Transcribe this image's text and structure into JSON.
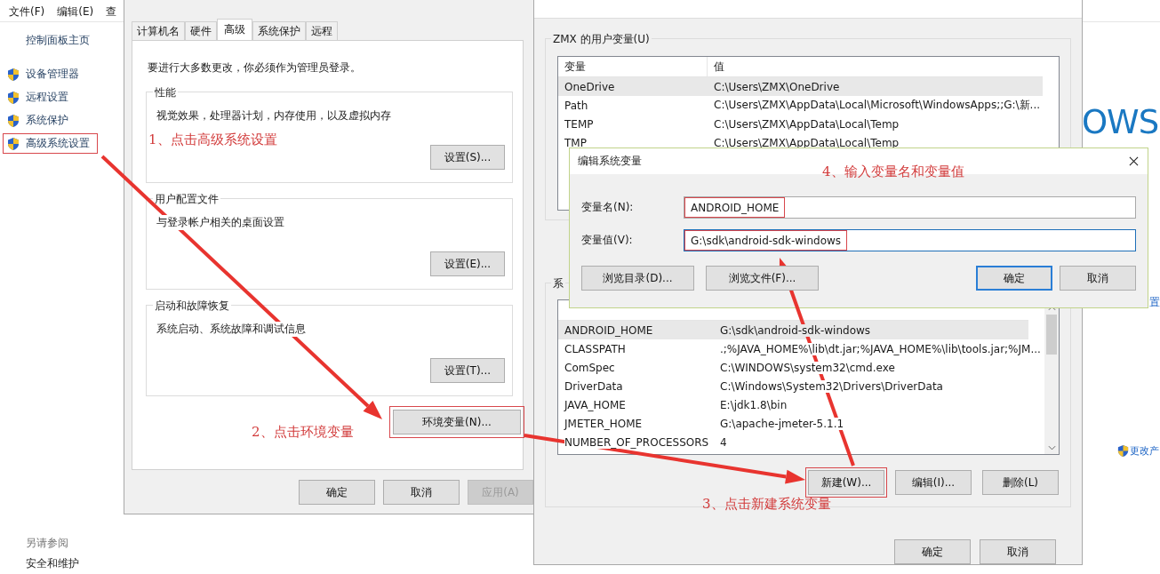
{
  "control_panel": {
    "menu": [
      "文件(F)",
      "编辑(E)",
      "查"
    ],
    "home_link": "控制面板主页",
    "tasks": [
      {
        "label": "设备管理器",
        "highlighted": false
      },
      {
        "label": "远程设置",
        "highlighted": false
      },
      {
        "label": "系统保护",
        "highlighted": false
      },
      {
        "label": "高级系统设置",
        "highlighted": true
      }
    ],
    "see_also_heading": "另请参阅",
    "see_also_link": "安全和维护",
    "brand_text": "OWS",
    "side_link": "置",
    "change_link": "更改产"
  },
  "system_properties": {
    "tabs": [
      {
        "label": "计算机名",
        "selected": false
      },
      {
        "label": "硬件",
        "selected": false
      },
      {
        "label": "高级",
        "selected": true
      },
      {
        "label": "系统保护",
        "selected": false
      },
      {
        "label": "远程",
        "selected": false
      }
    ],
    "admin_note": "要进行大多数更改，你必须作为管理员登录。",
    "groups": [
      {
        "title": "性能",
        "description": "视觉效果，处理器计划，内存使用，以及虚拟内存",
        "button": "设置(S)..."
      },
      {
        "title": "用户配置文件",
        "description": "与登录帐户相关的桌面设置",
        "button": "设置(E)..."
      },
      {
        "title": "启动和故障恢复",
        "description": "系统启动、系统故障和调试信息",
        "button": "设置(T)..."
      }
    ],
    "env_button": {
      "label": "环境变量(N)...",
      "highlighted": true
    },
    "buttons": [
      {
        "label": "确定",
        "disabled": false
      },
      {
        "label": "取消",
        "disabled": false
      },
      {
        "label": "应用(A)",
        "disabled": true
      }
    ]
  },
  "environment_variables": {
    "user_group_title": "ZMX 的用户变量(U)",
    "columns": [
      "变量",
      "值"
    ],
    "user_rows": [
      {
        "name": "OneDrive",
        "value": "C:\\Users\\ZMX\\OneDrive",
        "selected": true
      },
      {
        "name": "Path",
        "value": "C:\\Users\\ZMX\\AppData\\Local\\Microsoft\\WindowsApps;;G:\\新...",
        "selected": false
      },
      {
        "name": "TEMP",
        "value": "C:\\Users\\ZMX\\AppData\\Local\\Temp",
        "selected": false
      },
      {
        "name": "TMP",
        "value": "C:\\Users\\ZMX\\AppData\\Local\\Temp",
        "selected": false
      }
    ],
    "system_group_title": "系",
    "system_rows": [
      {
        "name": "ANDROID_HOME",
        "value": "G:\\sdk\\android-sdk-windows",
        "selected": true
      },
      {
        "name": "CLASSPATH",
        "value": ".;%JAVA_HOME%\\lib\\dt.jar;%JAVA_HOME%\\lib\\tools.jar;%JM...",
        "selected": false
      },
      {
        "name": "ComSpec",
        "value": "C:\\WINDOWS\\system32\\cmd.exe",
        "selected": false
      },
      {
        "name": "DriverData",
        "value": "C:\\Windows\\System32\\Drivers\\DriverData",
        "selected": false
      },
      {
        "name": "JAVA_HOME",
        "value": "E:\\jdk1.8\\bin",
        "selected": false
      },
      {
        "name": "JMETER_HOME",
        "value": "G:\\apache-jmeter-5.1.1",
        "selected": false
      },
      {
        "name": "NUMBER_OF_PROCESSORS",
        "value": "4",
        "selected": false
      }
    ],
    "system_buttons": [
      {
        "label": "新建(W)...",
        "highlighted": true
      },
      {
        "label": "编辑(I)...",
        "highlighted": false
      },
      {
        "label": "删除(L)",
        "highlighted": false
      }
    ],
    "buttons": [
      "确定",
      "取消"
    ]
  },
  "edit_dialog": {
    "title": "编辑系统变量",
    "fields": [
      {
        "label": "变量名(N):",
        "value": "ANDROID_HOME",
        "focused": false
      },
      {
        "label": "变量值(V):",
        "value": "G:\\sdk\\android-sdk-windows",
        "focused": true
      }
    ],
    "browse_buttons": [
      "浏览目录(D)...",
      "浏览文件(F)..."
    ],
    "buttons": [
      {
        "label": "确定",
        "default": true
      },
      {
        "label": "取消",
        "default": false
      }
    ]
  },
  "annotations": [
    "1、点击高级系统设置",
    "2、点击环境变量",
    "3、点击新建系统变量",
    "4、输入变量名和变量值"
  ]
}
